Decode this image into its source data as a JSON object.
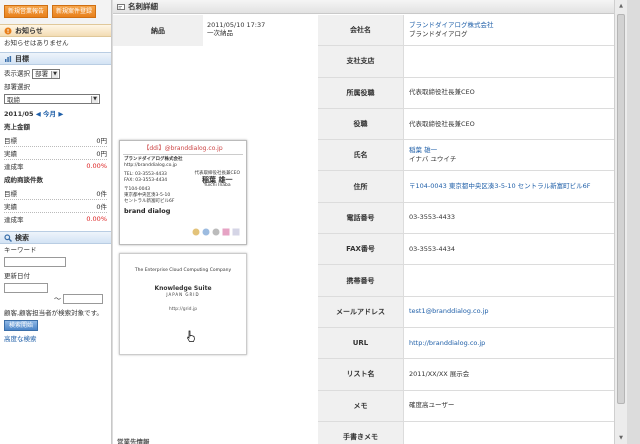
{
  "sidebar": {
    "buttons": [
      "新規営業報告",
      "新規案件登録"
    ],
    "notice": {
      "title": "お知らせ",
      "text": "お知らせはありません"
    },
    "goals": {
      "title": "目標",
      "display_label": "表示選択",
      "display_value": "部署",
      "dept_label": "部署選択",
      "dept_value": "取締",
      "period": "2011/05",
      "this_month": "今月",
      "sales_title": "売上金額",
      "sales_rows": [
        {
          "label": "目標",
          "value": "0円"
        },
        {
          "label": "実績",
          "value": "0円"
        },
        {
          "label": "達成率",
          "value": "0.00%"
        }
      ],
      "deals_title": "成約商談件数",
      "deals_rows": [
        {
          "label": "目標",
          "value": "0件"
        },
        {
          "label": "実績",
          "value": "0件"
        },
        {
          "label": "達成率",
          "value": "0.00%"
        }
      ]
    },
    "search": {
      "title": "検索",
      "keyword_label": "キーワード",
      "date_label": "更新日付",
      "tilde": "～",
      "note": "顧客,顧客担当者が検索対象です。",
      "search_button": "検索開始",
      "advanced": "高度な検索"
    }
  },
  "main": {
    "header": "名刺詳細",
    "info": {
      "label": "納品",
      "date": "2011/05/10 17:37",
      "type": "一次納品"
    },
    "card": {
      "top_title": "【ddi】@branddialog.co.jp",
      "company": "ブランドダイアログ株式会社",
      "url": "http://branddialog.co.jp",
      "tel": "TEL: 03-3553-4433",
      "fax": "FAX: 03-3553-4434",
      "position": "代表取締役社長兼CEO",
      "name": "稲葉 雄一",
      "name_en": "Yuichi Inaba",
      "postal": "〒104-0043",
      "address": "東京都中央区湊3-5-10",
      "building": "セントラル新富町ビル6F",
      "logo": "brand dialog",
      "slogan": "The Enterprise Cloud Computing Company",
      "product": "Knowledge Suite",
      "product_sub": "JAPAN GRID",
      "back_url": "http://grid.jp"
    },
    "fields": [
      {
        "label": "会社名",
        "values": [
          "ブランドダイアログ株式会社",
          "ブランドダイアログ"
        ],
        "link": true
      },
      {
        "label": "支社支店",
        "values": [],
        "link": false
      },
      {
        "label": "所属役職",
        "values": [
          "代表取締役社長兼CEO"
        ],
        "link": false
      },
      {
        "label": "役職",
        "values": [
          "代表取締役社長兼CEO"
        ],
        "link": false
      },
      {
        "label": "氏名",
        "values": [
          "稲葉 雄一",
          "イナバ ユウイチ"
        ],
        "link": true
      },
      {
        "label": "住所",
        "values": [
          "〒104-0043 東京都中央区湊3-5-10 セントラル新富町ビル6F"
        ],
        "link": true
      },
      {
        "label": "電話番号",
        "values": [
          "03-3553-4433"
        ],
        "link": false
      },
      {
        "label": "FAX番号",
        "values": [
          "03-3553-4434"
        ],
        "link": false
      },
      {
        "label": "携帯番号",
        "values": [],
        "link": false
      },
      {
        "label": "メールアドレス",
        "values": [
          "test1@branddialog.co.jp"
        ],
        "link": true
      },
      {
        "label": "URL",
        "values": [
          "http://branddialog.co.jp"
        ],
        "link": true
      },
      {
        "label": "リスト名",
        "values": [
          "2011/XX/XX 展示会"
        ],
        "link": false
      },
      {
        "label": "メモ",
        "values": [
          "確度高ユーザー"
        ],
        "link": false
      },
      {
        "label": "手書きメモ",
        "values": [],
        "link": false
      }
    ],
    "bottom_label": "営業先情報"
  },
  "colors": {
    "accent_orange": "#e8801c",
    "link_blue": "#1f5fa8",
    "rate_red": "#d22222"
  }
}
